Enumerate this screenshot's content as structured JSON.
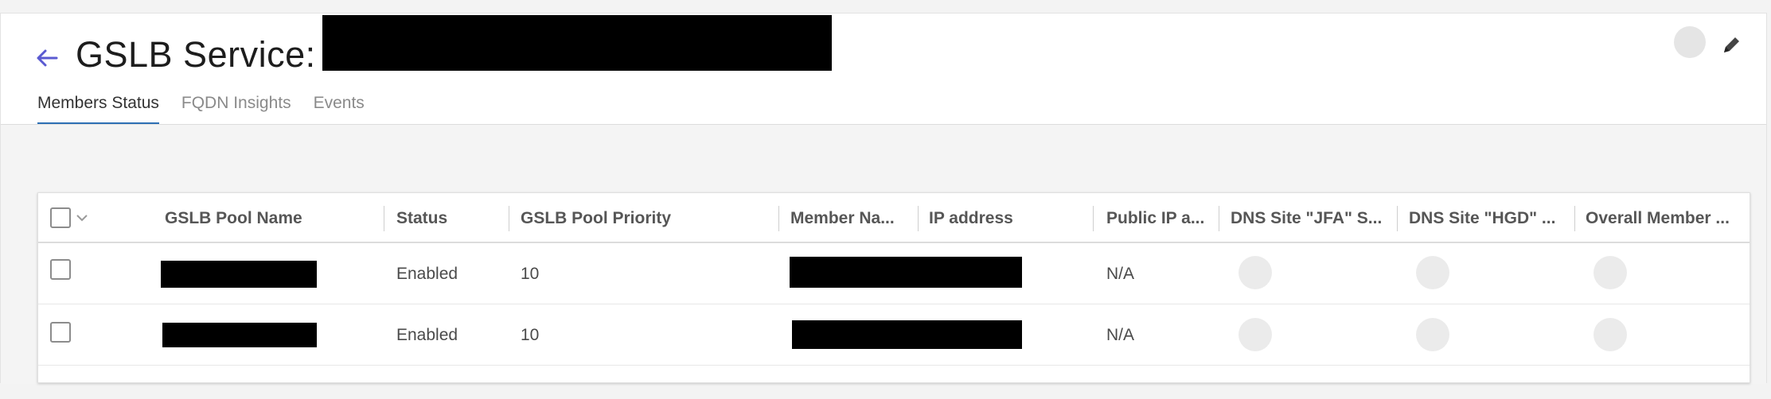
{
  "header": {
    "title": "GSLB Service:",
    "back_icon": "back-arrow-icon",
    "edit_icon": "pencil-icon",
    "accent_color": "#5a5ad1"
  },
  "tabs": [
    {
      "label": "Members Status",
      "active": true
    },
    {
      "label": "FQDN Insights",
      "active": false
    },
    {
      "label": "Events",
      "active": false
    }
  ],
  "table": {
    "columns": [
      "GSLB Pool Name",
      "Status",
      "GSLB Pool Priority",
      "Member Na...",
      "IP address",
      "Public IP a...",
      "DNS Site \"JFA\" S...",
      "DNS Site \"HGD\" ...",
      "Overall Member ..."
    ],
    "rows": [
      {
        "status": "Enabled",
        "priority": "10",
        "public_ip": "N/A"
      },
      {
        "status": "Enabled",
        "priority": "10",
        "public_ip": "N/A"
      }
    ]
  }
}
